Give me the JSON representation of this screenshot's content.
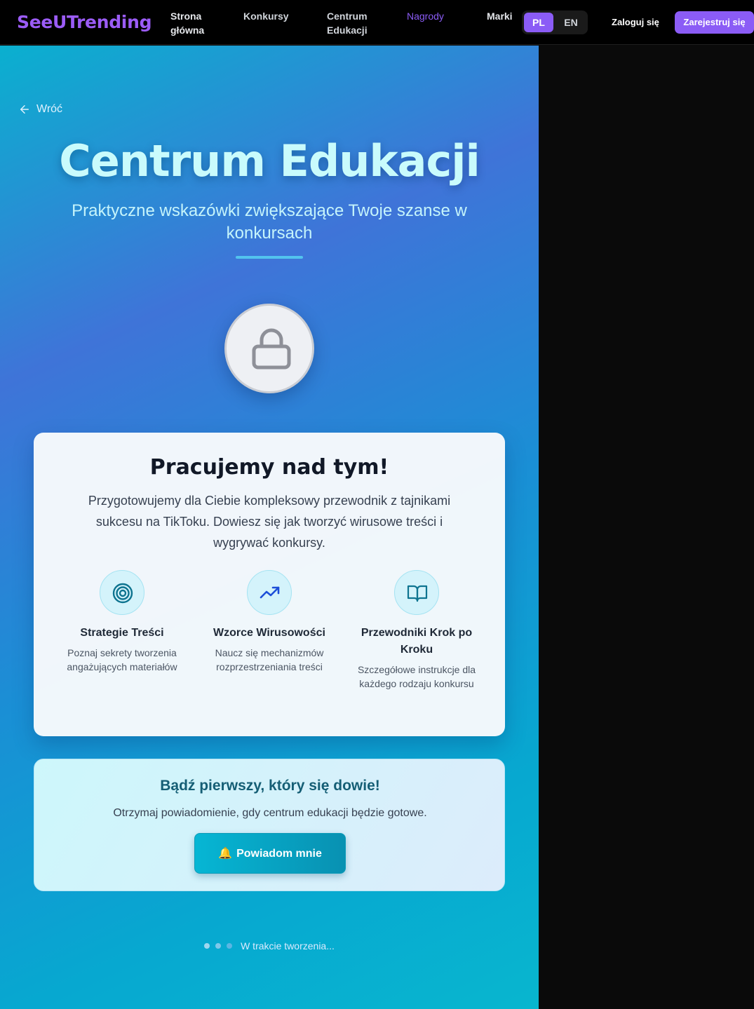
{
  "nav": {
    "logo": "SeeUTrending",
    "links": [
      {
        "label_line1": "Strona",
        "label_line2": "główna"
      },
      {
        "label": "Konkursy"
      },
      {
        "label_line1": "Centrum",
        "label_line2": "Edukacji"
      },
      {
        "label": "Nagrody"
      },
      {
        "label": "Marki"
      }
    ],
    "lang": {
      "pl": "PL",
      "en": "EN",
      "selected": "PL"
    },
    "login": "Zaloguj się",
    "signup": "Zarejestruj się"
  },
  "hero": {
    "back": "Wróć",
    "title": "Centrum Edukacji",
    "subtitle": "Praktyczne wskazówki zwiększające Twoje szanse w konkursach"
  },
  "card": {
    "title": "Pracujemy nad tym!",
    "text": "Przygotowujemy dla Ciebie kompleksowy przewodnik z tajnikami sukcesu na TikToku. Dowiesz się jak tworzyć wirusowe treści i wygrywać konkursy.",
    "features": [
      {
        "icon": "target-icon",
        "title": "Strategie Treści",
        "desc": "Poznaj sekrety tworzenia angażujących materiałów"
      },
      {
        "icon": "trending-up-icon",
        "title": "Wzorce Wirusowości",
        "desc": "Naucz się mechanizmów rozprzestrzeniania treści"
      },
      {
        "icon": "book-open-icon",
        "title": "Przewodniki Krok po Kroku",
        "desc": "Szczegółowe instrukcje dla każdego rodzaju konkursu"
      }
    ]
  },
  "notify": {
    "title": "Bądź pierwszy, który się dowie!",
    "text": "Otrzymaj powiadomienie, gdy centrum edukacji będzie gotowe.",
    "button": "Powiadom mnie"
  },
  "status": "W trakcie tworzenia...",
  "colors": {
    "accent": "#8b5cf6",
    "cyan": "#06b6d4"
  }
}
